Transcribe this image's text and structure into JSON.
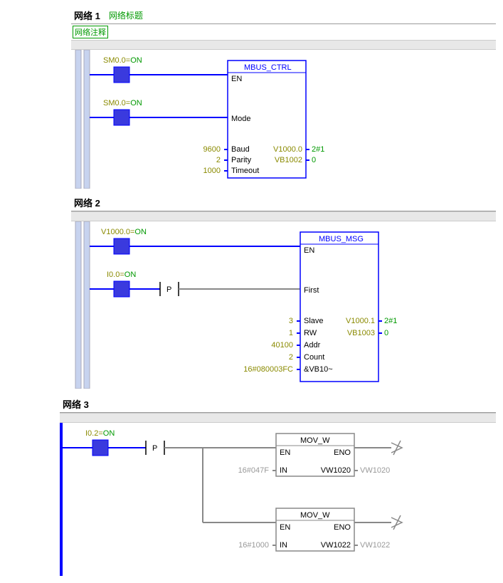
{
  "networks": [
    {
      "header": "网络 1",
      "title_link": "网络标题",
      "comment": "网络注释",
      "rails": true,
      "rungs": [
        {
          "contact_label": "SM0.0=",
          "contact_state": "ON",
          "target_pin": "EN"
        },
        {
          "contact_label": "SM0.0=",
          "contact_state": "ON",
          "target_pin": "Mode"
        }
      ],
      "block": {
        "title": "MBUS_CTRL",
        "inputs": [
          {
            "pin": "EN"
          },
          {
            "pin": "Mode"
          },
          {
            "pin": "Baud",
            "value": "9600"
          },
          {
            "pin": "Parity",
            "value": "2"
          },
          {
            "pin": "Timeout",
            "value": "1000"
          }
        ],
        "outputs": [
          {
            "pin": "V1000.0",
            "value": "2#1"
          },
          {
            "pin": "VB1002",
            "value": "0"
          }
        ]
      }
    },
    {
      "header": "网络 2",
      "rails": true,
      "rungs": [
        {
          "contact_label": "V1000.0=",
          "contact_state": "ON",
          "target_pin": "EN"
        },
        {
          "contact_label": "I0.0=",
          "contact_state": "ON",
          "edge": "P",
          "target_pin": "First"
        }
      ],
      "block": {
        "title": "MBUS_MSG",
        "inputs": [
          {
            "pin": "EN"
          },
          {
            "pin": "First"
          },
          {
            "pin": "Slave",
            "value": "3"
          },
          {
            "pin": "RW",
            "value": "1"
          },
          {
            "pin": "Addr",
            "value": "40100"
          },
          {
            "pin": "Count",
            "value": "2"
          },
          {
            "pin": "&VB10~",
            "value": "16#080003FC"
          }
        ],
        "outputs": [
          {
            "pin": "V1000.1",
            "value": "2#1"
          },
          {
            "pin": "VB1003",
            "value": "0"
          }
        ]
      }
    },
    {
      "header": "网络 3",
      "rails": false,
      "rungs": [
        {
          "contact_label": "I0.2=",
          "contact_state": "ON",
          "edge": "P"
        }
      ],
      "blocks": [
        {
          "title": "MOV_W",
          "in_label": "IN",
          "in_value": "16#047F",
          "en_label": "EN",
          "eno_label": "ENO",
          "out_pin": "VW1020",
          "out_value": "VW1020"
        },
        {
          "title": "MOV_W",
          "in_label": "IN",
          "in_value": "16#1000",
          "en_label": "EN",
          "eno_label": "ENO",
          "out_pin": "VW1022",
          "out_value": "VW1022"
        }
      ]
    }
  ]
}
